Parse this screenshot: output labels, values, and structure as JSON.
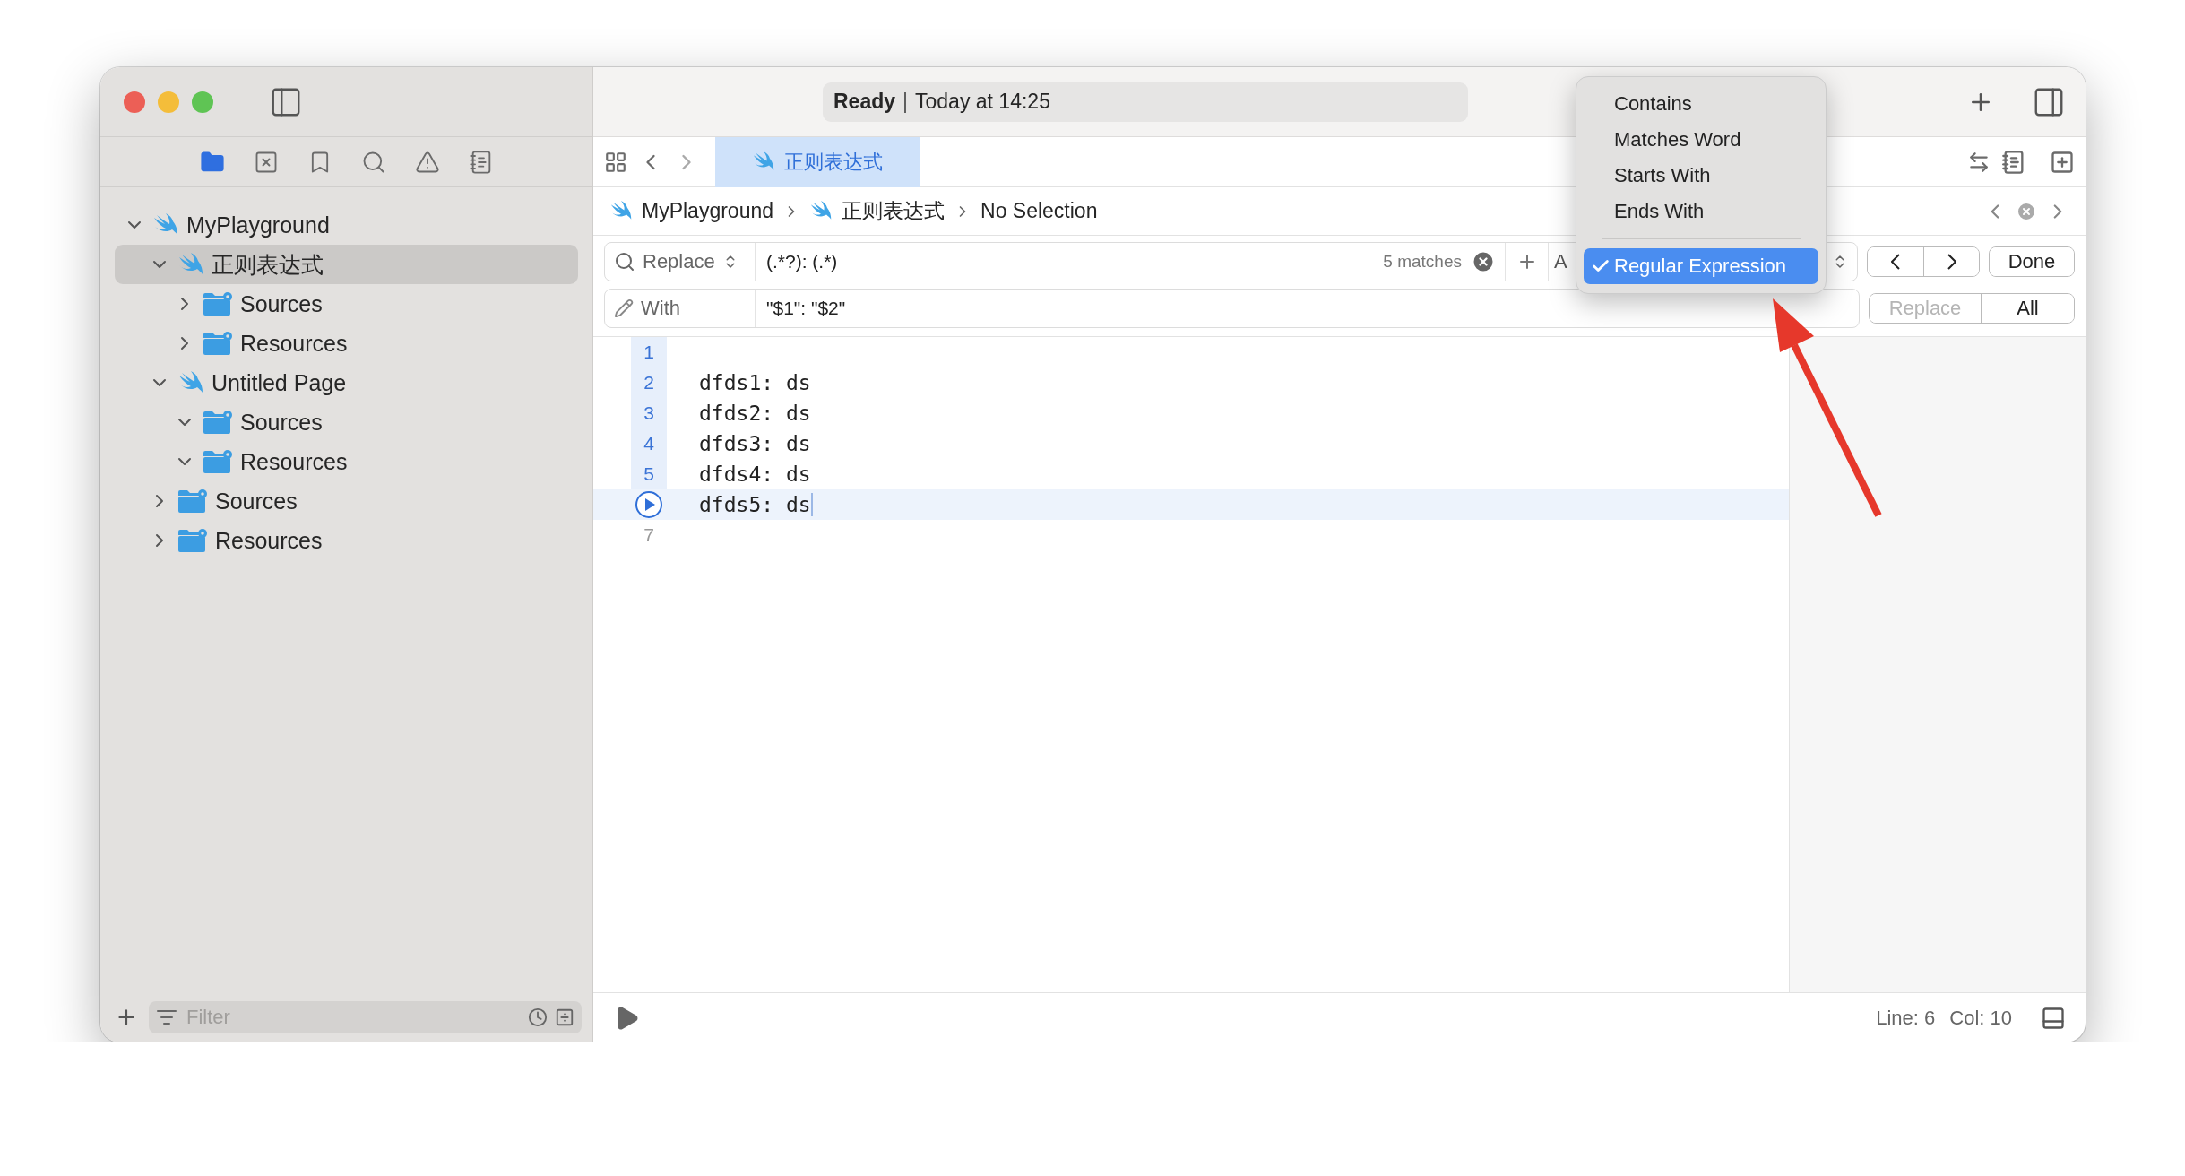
{
  "window": {
    "status_state": "Ready",
    "status_separator": "|",
    "status_time": "Today at 14:25"
  },
  "navigator_tabs": [
    {
      "kind": "folder",
      "selected": true
    },
    {
      "kind": "source-control",
      "selected": false
    },
    {
      "kind": "bookmark",
      "selected": false
    },
    {
      "kind": "search",
      "selected": false
    },
    {
      "kind": "warning",
      "selected": false
    },
    {
      "kind": "report",
      "selected": false
    }
  ],
  "tree": [
    {
      "label": "MyPlayground",
      "kind": "playground",
      "expanded": true,
      "selected": false,
      "children": [
        {
          "label": "正则表达式",
          "kind": "playground",
          "expanded": true,
          "selected": true,
          "children": [
            {
              "label": "Sources",
              "kind": "folder",
              "expanded": false,
              "selected": false
            },
            {
              "label": "Resources",
              "kind": "folder",
              "expanded": false,
              "selected": false
            }
          ]
        },
        {
          "label": "Untitled Page",
          "kind": "playground",
          "expanded": true,
          "selected": false,
          "children": [
            {
              "label": "Sources",
              "kind": "folder",
              "expanded": true,
              "selected": false
            },
            {
              "label": "Resources",
              "kind": "folder",
              "expanded": true,
              "selected": false
            }
          ]
        },
        {
          "label": "Sources",
          "kind": "folder",
          "expanded": false,
          "selected": false
        },
        {
          "label": "Resources",
          "kind": "folder",
          "expanded": false,
          "selected": false
        }
      ]
    }
  ],
  "sidebar_filter": {
    "placeholder": "Filter"
  },
  "editor_tabs": [
    {
      "label": "正则表达式",
      "selected": true
    }
  ],
  "jump_bar": [
    {
      "label": "MyPlayground",
      "kind": "playground"
    },
    {
      "label": "正则表达式",
      "kind": "playground"
    },
    {
      "label": "No Selection",
      "kind": "text"
    }
  ],
  "find": {
    "mode": "Replace",
    "query": "(.*?): (.*)",
    "matches": "5 matches",
    "option": "A",
    "with_label": "With",
    "replacement": "\"$1\": \"$2\"",
    "done": "Done",
    "replace": "Replace",
    "replace_disabled": true,
    "all": "All"
  },
  "code": [
    {
      "number": "1",
      "highlighted": true,
      "current": false
    },
    {
      "number": "2",
      "text": "dfds1: ds",
      "highlighted": true,
      "current": false
    },
    {
      "number": "3",
      "text": "dfds2: ds",
      "highlighted": true,
      "current": false
    },
    {
      "number": "4",
      "text": "dfds3: ds",
      "highlighted": true,
      "current": false
    },
    {
      "number": "5",
      "text": "dfds4: ds",
      "highlighted": true,
      "current": false
    },
    {
      "text": "dfds5: ds",
      "highlighted": false,
      "current": true
    },
    {
      "number": "7",
      "highlighted": false,
      "current": false
    }
  ],
  "match_menu": [
    {
      "label": "Contains",
      "selected": false
    },
    {
      "label": "Matches Word",
      "selected": false
    },
    {
      "label": "Starts With",
      "selected": false
    },
    {
      "label": "Ends With",
      "selected": false
    },
    {
      "label": "Regular Expression",
      "selected": true
    }
  ],
  "status_bar": {
    "line": "Line: 6",
    "column": "Col: 10"
  }
}
